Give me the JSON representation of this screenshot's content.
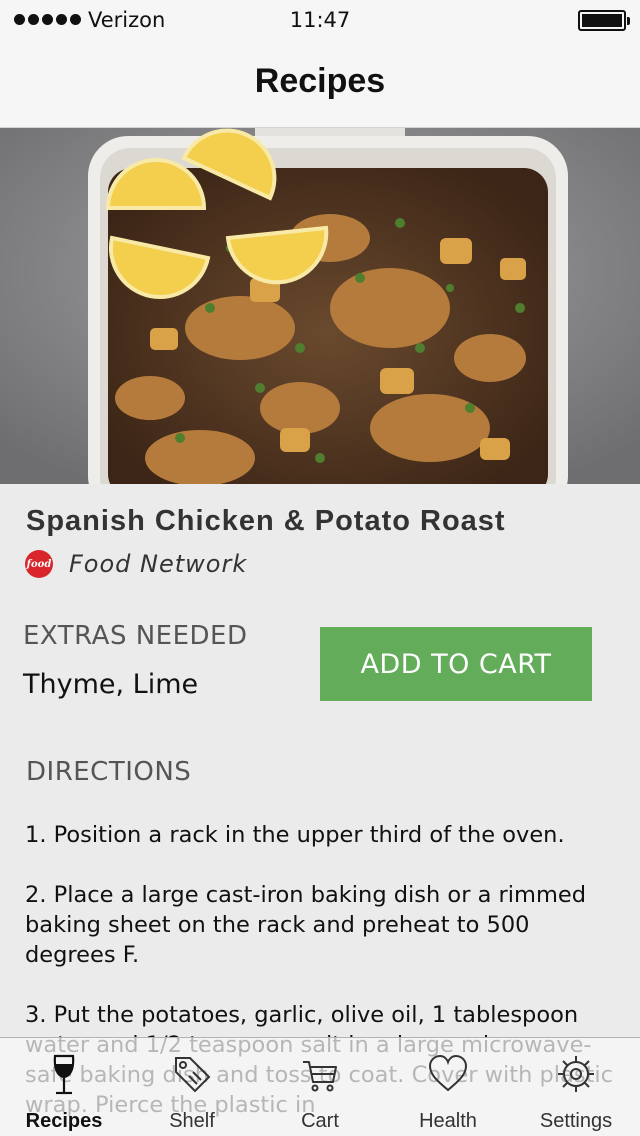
{
  "status_bar": {
    "carrier": "Verizon",
    "time": "11:47",
    "signal_icon": "signal-dots-icon",
    "battery_icon": "battery-full-icon"
  },
  "nav": {
    "title": "Recipes"
  },
  "recipe": {
    "title": "Spanish Chicken & Potato Roast",
    "source_logo_text": "food",
    "source": "Food Network",
    "extras_label": "EXTRAS NEEDED",
    "extras_value": "Thyme, Lime",
    "add_to_cart": "ADD TO CART",
    "directions_label": "DIRECTIONS",
    "steps": [
      "1. Position a rack in the upper third of the oven.",
      "2. Place a large cast-iron baking dish or a rimmed baking sheet on the rack and preheat to 500 degrees F.",
      "3. Put the potatoes, garlic, olive oil, 1 tablespoon water and 1/2 teaspoon salt in a large microwave-safe baking dish and toss to coat. Cover with plastic wrap. Pierce the plastic in"
    ]
  },
  "tab_bar": {
    "tabs": [
      {
        "label": "Recipes",
        "icon": "wine-glass-icon",
        "active": true
      },
      {
        "label": "Shelf",
        "icon": "price-tag-icon",
        "active": false
      },
      {
        "label": "Cart",
        "icon": "cart-icon",
        "active": false
      },
      {
        "label": "Health",
        "icon": "heart-icon",
        "active": false
      },
      {
        "label": "Settings",
        "icon": "gear-icon",
        "active": false
      }
    ]
  },
  "colors": {
    "accent": "#63ad5a",
    "brand_logo": "#d8262b"
  }
}
